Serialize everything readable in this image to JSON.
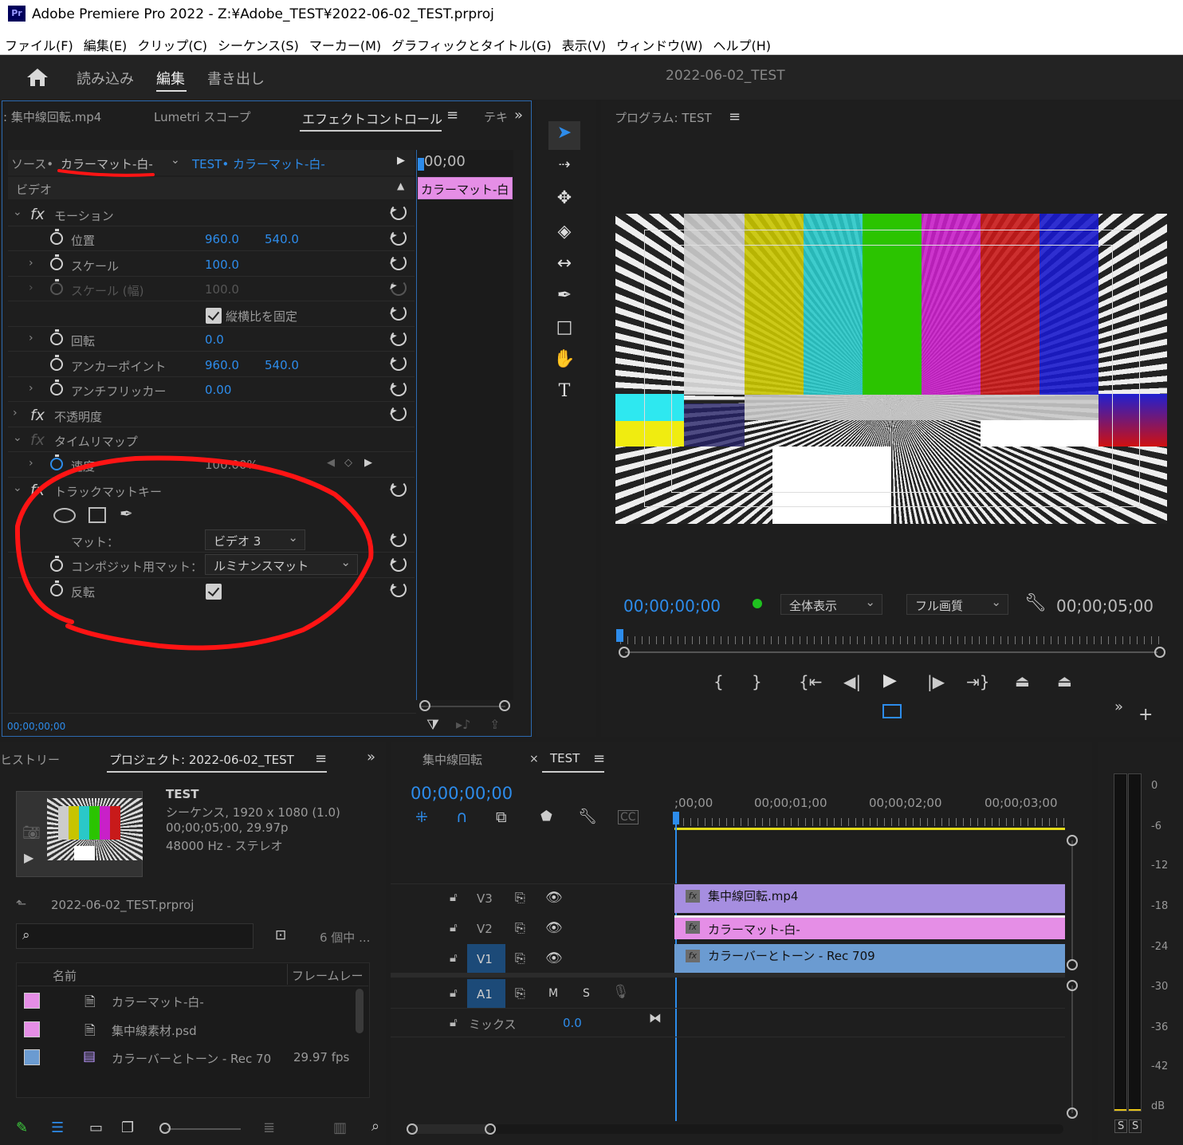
{
  "app": {
    "icon": "Pr",
    "title": "Adobe Premiere Pro 2022 - Z:¥Adobe_TEST¥2022-06-02_TEST.prproj"
  },
  "menu": [
    "ファイル(F)",
    "編集(E)",
    "クリップ(C)",
    "シーケンス(S)",
    "マーカー(M)",
    "グラフィックとタイトル(G)",
    "表示(V)",
    "ウィンドウ(W)",
    "ヘルプ(H)"
  ],
  "workspace": {
    "tabs": [
      "読み込み",
      "編集",
      "書き出し"
    ],
    "active": "編集",
    "project_name": "2022-06-02_TEST"
  },
  "effect_panel": {
    "tabs": [
      ": 集中線回転.mp4",
      "Lumetri スコープ",
      "エフェクトコントロール",
      "テキ"
    ],
    "source_prefix": "ソース•",
    "source_clip": "カラーマット-白-",
    "sequence_clip": "TEST• カラーマット-白-",
    "timecode_head": "00;00",
    "clip_bar": "カラーマット-白",
    "section_video": "ビデオ",
    "motion": "モーション",
    "position_label": "位置",
    "position_x": "960.0",
    "position_y": "540.0",
    "scale_label": "スケール",
    "scale": "100.0",
    "scale_width_label": "スケール (幅)",
    "scale_width": "100.0",
    "uniform_label": "縦横比を固定",
    "rotation_label": "回転",
    "rotation": "0.0",
    "anchor_label": "アンカーポイント",
    "anchor_x": "960.0",
    "anchor_y": "540.0",
    "flicker_label": "アンチフリッカー",
    "flicker": "0.00",
    "opacity": "不透明度",
    "time_remap": "タイムリマップ",
    "speed_label": "速度",
    "speed": "100.00%",
    "track_matte": "トラックマットキー",
    "matte_label": "マット：",
    "matte_value": "ビデオ 3",
    "composite_label": "コンポジット用マット：",
    "composite_value": "ルミナンスマット",
    "reverse_label": "反転",
    "footer_tc": "00;00;00;00"
  },
  "program": {
    "title": "プログラム: TEST",
    "timecode": "00;00;00;00",
    "zoom": "全体表示",
    "quality": "フル画質",
    "duration": "00;00;05;00"
  },
  "project_panel": {
    "tabs": [
      "ヒストリー",
      "プロジェクト: 2022-06-02_TEST"
    ],
    "seq_name": "TEST",
    "seq_line1": "シーケンス, 1920 x 1080 (1.0)",
    "seq_line2": "00;00;05;00, 29.97p",
    "seq_line3": "48000 Hz - ステレオ",
    "file": "2022-06-02_TEST.prproj",
    "item_count": "6 個中 ...",
    "col_name": "名前",
    "col_rate": "フレームレー",
    "items": [
      {
        "name": "カラーマット-白-",
        "rate": "",
        "color": "#e58ee6"
      },
      {
        "name": "集中線素材.psd",
        "rate": "",
        "color": "#e58ee6"
      },
      {
        "name": "カラーバーとトーン - Rec 70",
        "rate": "29.97 fps",
        "color": "#6b9bd1"
      }
    ]
  },
  "timeline": {
    "tabs": [
      "集中線回転",
      "TEST"
    ],
    "timecode": "00;00;00;00",
    "ruler": [
      ";00;00",
      "00;00;01;00",
      "00;00;02;00",
      "00;00;03;00"
    ],
    "tracks": {
      "v3": "V3",
      "v2": "V2",
      "v1": "V1",
      "a1": "A1",
      "mix": "ミックス",
      "mix_value": "0.0",
      "m": "M",
      "s": "S"
    },
    "clips": [
      {
        "name": "集中線回転.mp4",
        "color": "#a68ee0"
      },
      {
        "name": "カラーマット-白-",
        "color": "#e58ee6"
      },
      {
        "name": "カラーバーとトーン - Rec 709",
        "color": "#6b9bd1"
      }
    ]
  },
  "meter": {
    "labels": [
      "0",
      "-6",
      "-12",
      "-18",
      "-24",
      "-30",
      "-36",
      "-42",
      "dB"
    ],
    "solo": [
      "S",
      "S"
    ]
  }
}
